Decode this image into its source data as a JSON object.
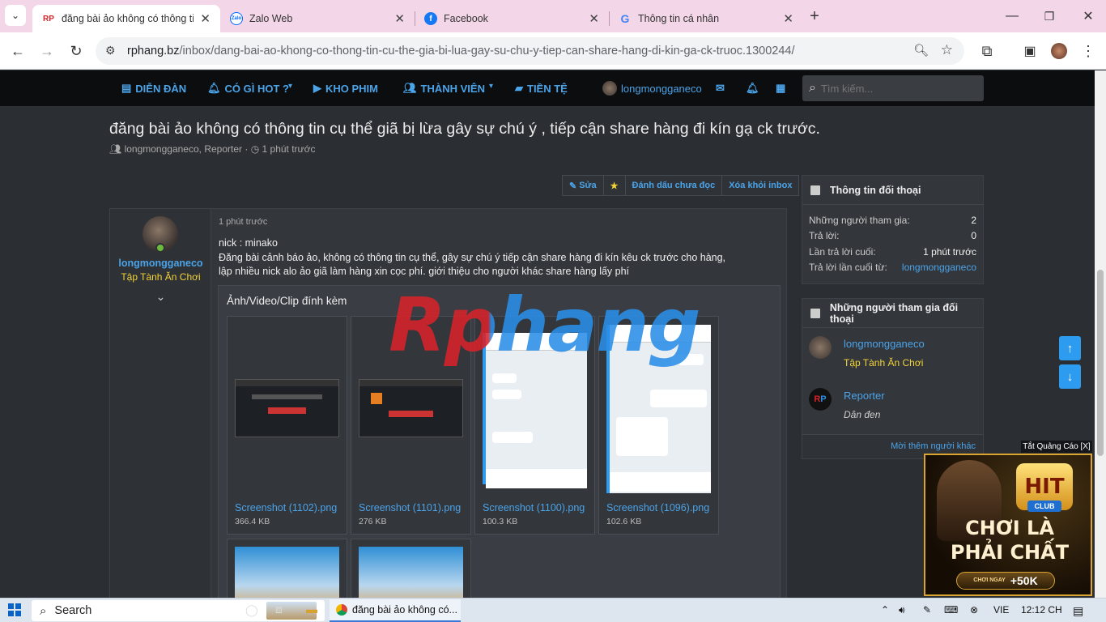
{
  "browser": {
    "tabs": [
      {
        "title": "đăng bài ảo không có thông tin",
        "icon": "rphang-favicon",
        "active": true
      },
      {
        "title": "Zalo Web",
        "icon": "zalo-favicon",
        "active": false
      },
      {
        "title": "Facebook",
        "icon": "facebook-favicon",
        "active": false
      },
      {
        "title": "Thông tin cá nhân",
        "icon": "google-favicon",
        "active": false
      }
    ],
    "url_domain": "rphang.bz",
    "url_path": "/inbox/dang-bai-ao-khong-co-thong-tin-cu-the-gia-bi-lua-gay-su-chu-y-tiep-can-share-hang-di-kin-ga-ck-truoc.1300244/"
  },
  "nav": {
    "items": [
      {
        "label": "DIỄN ĐÀN",
        "icon": "chat-icon"
      },
      {
        "label": "CÓ GÌ HOT ?",
        "icon": "bell-icon"
      },
      {
        "label": "KHO PHIM",
        "icon": "video-icon"
      },
      {
        "label": "THÀNH VIÊN",
        "icon": "users-icon"
      },
      {
        "label": "TIỀN TỆ",
        "icon": "folder-icon"
      }
    ],
    "username": "longmongganeco",
    "search_placeholder": "Tìm kiếm..."
  },
  "thread": {
    "title": "đăng bài ảo không có thông tin cụ thể giã bị lừa gây sự chú ý , tiếp cận share hàng đi kín gạ ck trước.",
    "author_line": "longmongganeco, Reporter",
    "time": "1 phút trước",
    "actions": {
      "edit": "Sửa",
      "star": "★",
      "mark_unread": "Đánh dấu chưa đọc",
      "remove": "Xóa khỏi inbox"
    }
  },
  "post": {
    "username": "longmongganeco",
    "role": "Tập Tành Ăn Chơi",
    "time": "1 phút trước",
    "line1": "nick : minako",
    "line2": "Đăng bài cảnh báo ảo, không có thông tin cụ thể, gây sự chú ý tiếp cận share hàng đi kín kêu ck trước cho hàng,",
    "line3": "lập nhiều nick alo ảo giã làm hàng xin cọc phí. giới thiệu cho người khác share hàng lấy phí",
    "attachments_title": "Ảnh/Video/Clip đính kèm",
    "attachments": [
      {
        "name": "Screenshot (1102).png",
        "size": "366.4 KB"
      },
      {
        "name": "Screenshot (1101).png",
        "size": "276 KB"
      },
      {
        "name": "Screenshot (1100).png",
        "size": "100.3 KB"
      },
      {
        "name": "Screenshot (1096).png",
        "size": "102.6 KB"
      }
    ],
    "watermark": "Rphang"
  },
  "sidebar": {
    "info_title": "Thông tin đối thoại",
    "info": [
      {
        "k": "Những người tham gia:",
        "v": "2"
      },
      {
        "k": "Trả lời:",
        "v": "0"
      },
      {
        "k": "Lần trả lời cuối:",
        "v": "1 phút trước"
      },
      {
        "k": "Trả lời lần cuối từ:",
        "v": "longmongganeco"
      }
    ],
    "participants_title": "Những người tham gia đối thoại",
    "participants": [
      {
        "name": "longmongganeco",
        "role": "Tập Tành Ăn Chơi"
      },
      {
        "name": "Reporter",
        "role": "Dân đen"
      }
    ],
    "invite": "Mời thêm người khác"
  },
  "ad": {
    "close": "Tắt Quảng Cáo [X]",
    "logo": "HIT",
    "club": "CLUB",
    "line1": "CHƠI LÀ",
    "line2": "PHẢI CHẤT",
    "cta_small": "CHƠI NGAY",
    "cta": "+50K"
  },
  "taskbar": {
    "search": "Search",
    "chrome_title": "đăng bài ảo không có...",
    "lang": "VIE",
    "time": "12:12 CH"
  },
  "colors": {
    "accent": "#4ba3e8",
    "role": "#f2d337",
    "nav_bg": "#0c0d0f",
    "page_bg": "#2b2e33"
  }
}
